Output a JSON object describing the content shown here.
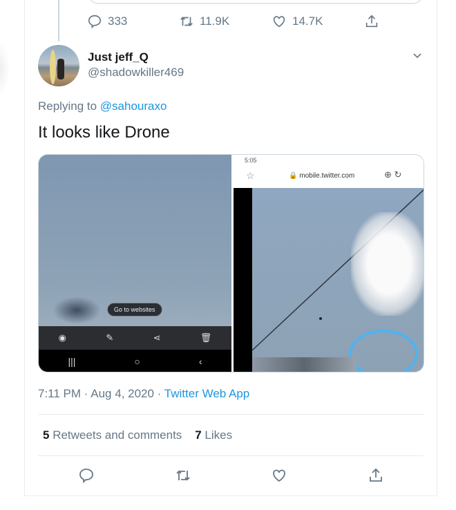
{
  "prev_tweet": {
    "actions": {
      "replies": "333",
      "retweets": "11.9K",
      "likes": "14.7K"
    }
  },
  "tweet": {
    "display_name": "Just jeff_Q",
    "handle": "@shadowkiller469",
    "replying_prefix": "Replying to",
    "replying_to": "@sahouraxo",
    "text": "It looks like Drone",
    "media": {
      "left": {
        "tooltip": "Go to websites"
      },
      "right": {
        "time": "5:05",
        "url": "mobile.twitter.com"
      }
    },
    "time": "7:11 PM",
    "date": "Aug 4, 2020",
    "source": "Twitter Web App",
    "separator": "·",
    "stats": {
      "retweets_count": "5",
      "retweets_label": "Retweets and comments",
      "likes_count": "7",
      "likes_label": "Likes"
    }
  }
}
